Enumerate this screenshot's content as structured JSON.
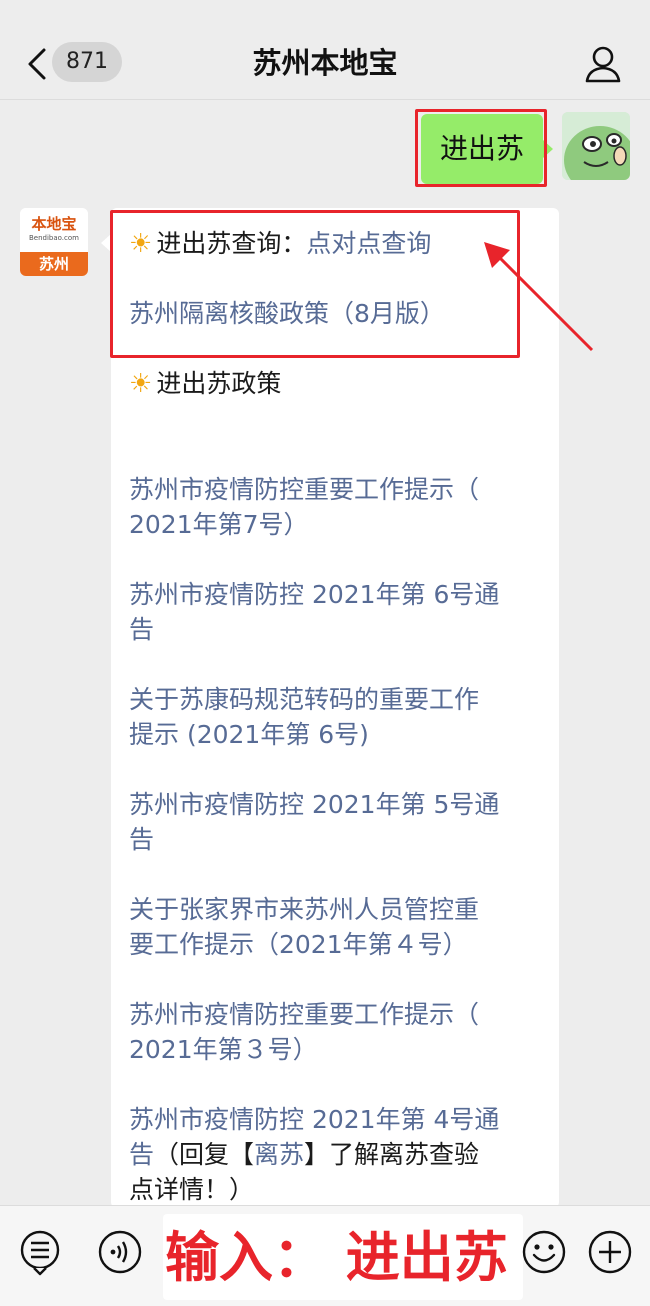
{
  "header": {
    "unread_count": "871",
    "title": "苏州本地宝"
  },
  "sent_message": "进出苏",
  "account_avatar": {
    "logo_name": "本地宝",
    "logo_url": "Bendibao.com",
    "city": "苏州"
  },
  "received_message": {
    "query_prefix": "进出苏查询：",
    "query_link": "点对点查询",
    "policy_link": "苏州隔离核酸政策（8月版）",
    "policy_heading": "进出苏政策",
    "links": [
      {
        "line1": "苏州市疫情防控重要工作提示（",
        "line2": "2021年第7号）"
      },
      {
        "line1": "苏州市疫情防控 2021年第 6号通",
        "line2": "告"
      },
      {
        "line1": "关于苏康码规范转码的重要工作",
        "line2": "提示 (2021年第 6号)"
      },
      {
        "line1": "苏州市疫情防控 2021年第 5号通",
        "line2": "告"
      },
      {
        "line1": "关于张家界市来苏州人员管控重",
        "line2": "要工作提示（2021年第４号）"
      },
      {
        "line1": "苏州市疫情防控重要工作提示（",
        "line2": "2021年第３号）"
      }
    ],
    "last_item": {
      "line1_link": "苏州市疫情防控 2021年第 4号通",
      "line2_link": "告",
      "line2_text_a": "（回复【",
      "line2_link_b": "离苏",
      "line2_text_c": "】了解离苏查验",
      "line3_text": "点详情！）"
    }
  },
  "input_bar": {
    "overlay_text": "输入：  进出苏"
  },
  "colors": {
    "sent_bubble": "#95ec69",
    "link": "#576b95",
    "highlight": "#e8242b",
    "account_orange": "#ea6a1d"
  },
  "icons": [
    "back-icon",
    "profile-icon",
    "sun-icon",
    "menu-list-icon",
    "voice-icon",
    "emoji-icon",
    "plus-icon"
  ]
}
